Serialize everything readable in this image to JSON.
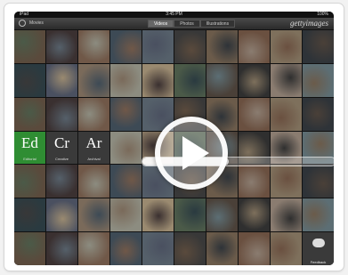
{
  "statusbar": {
    "carrier": "iPad",
    "time": "3:45 PM",
    "battery": "100%"
  },
  "toolbar": {
    "back_label": "Movies",
    "segments": [
      "Videos",
      "Photos",
      "Illustrations"
    ],
    "active_segment": 0,
    "logo": "gettyimages"
  },
  "apps": [
    {
      "abbr": "Ed",
      "label": "Editorial"
    },
    {
      "abbr": "Cr",
      "label": "Creative"
    },
    {
      "abbr": "Ar",
      "label": "Archival"
    }
  ],
  "grid_last_label": "Feedback",
  "video": {
    "progress_fraction": 0.45
  },
  "colors": {
    "accent_green": "#2f8d33",
    "tile_dark": "#2b2b2b"
  }
}
